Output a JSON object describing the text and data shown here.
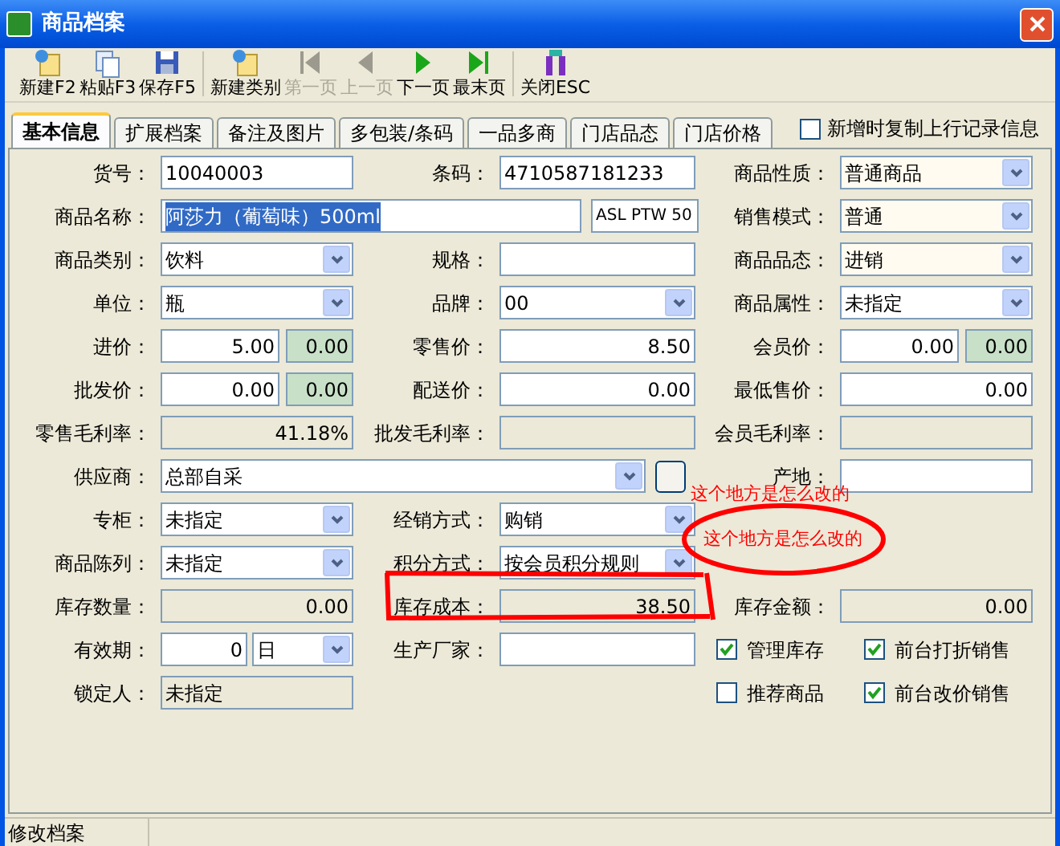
{
  "window": {
    "title": "商品档案"
  },
  "toolbar": [
    {
      "label": "新建F2",
      "kind": "new",
      "disabled": false,
      "separator_before": false
    },
    {
      "label": "粘贴F3",
      "kind": "paste",
      "disabled": false,
      "separator_before": false
    },
    {
      "label": "保存F5",
      "kind": "save",
      "disabled": false,
      "separator_before": false
    },
    {
      "label": "新建类别",
      "kind": "new",
      "disabled": false,
      "separator_before": true
    },
    {
      "label": "第一页",
      "kind": "first",
      "disabled": true,
      "separator_before": false
    },
    {
      "label": "上一页",
      "kind": "prev",
      "disabled": true,
      "separator_before": false
    },
    {
      "label": "下一页",
      "kind": "next",
      "disabled": false,
      "separator_before": false
    },
    {
      "label": "最末页",
      "kind": "last",
      "disabled": false,
      "separator_before": false
    },
    {
      "label": "关闭ESC",
      "kind": "exit",
      "disabled": false,
      "separator_before": true
    }
  ],
  "tabs": [
    {
      "label": "基本信息",
      "selected": true
    },
    {
      "label": "扩展档案",
      "selected": false
    },
    {
      "label": "备注及图片",
      "selected": false
    },
    {
      "label": "多包装/条码",
      "selected": false
    },
    {
      "label": "一品多商",
      "selected": false
    },
    {
      "label": "门店品态",
      "selected": false
    },
    {
      "label": "门店价格",
      "selected": false
    }
  ],
  "copy_option": {
    "label": "新增时复制上行记录信息",
    "checked": false
  },
  "form_rows": [
    {
      "cells": [
        {
          "kind": "text",
          "label": "货号：",
          "value": "10040003",
          "numeric": false
        },
        {
          "kind": "text",
          "label": "条码：",
          "value": "4710587181233",
          "numeric": false
        },
        {
          "kind": "combo",
          "label": "商品性质：",
          "value": "普通商品",
          "highlighted": true
        }
      ]
    },
    {
      "cells": [
        {
          "kind": "name",
          "label": "商品名称：",
          "value": "阿莎力（葡萄味）500ml",
          "text_selected": true,
          "extra": "ASL PTW 50"
        },
        {
          "kind": "combo",
          "label": "销售模式：",
          "value": "普通",
          "highlighted": true
        }
      ]
    },
    {
      "cells": [
        {
          "kind": "combo",
          "label": "商品类别：",
          "value": "饮料",
          "highlighted": false
        },
        {
          "kind": "text",
          "label": "规格："
        },
        {
          "kind": "combo",
          "label": "商品品态：",
          "value": "进销",
          "highlighted": true
        }
      ]
    },
    {
      "cells": [
        {
          "kind": "combo",
          "label": "单位：",
          "value": "瓶",
          "highlighted": false
        },
        {
          "kind": "combo",
          "label": "品牌：",
          "value": "00",
          "highlighted": false
        },
        {
          "kind": "combo",
          "label": "商品属性：",
          "value": "未指定",
          "highlighted": false
        }
      ]
    },
    {
      "cells": [
        {
          "kind": "price",
          "label": "进价：",
          "value": "5.00",
          "markup": "0.00"
        },
        {
          "kind": "text",
          "label": "零售价：",
          "value": "8.50",
          "numeric": true
        },
        {
          "kind": "price",
          "label": "会员价：",
          "value": "0.00",
          "markup": "0.00"
        }
      ]
    },
    {
      "cells": [
        {
          "kind": "price",
          "label": "批发价：",
          "value": "0.00",
          "markup": "0.00"
        },
        {
          "kind": "text",
          "label": "配送价：",
          "value": "0.00",
          "numeric": true
        },
        {
          "kind": "text",
          "label": "最低售价：",
          "value": "0.00",
          "numeric": true
        }
      ]
    },
    {
      "cells": [
        {
          "kind": "readonly",
          "label": "零售毛利率：",
          "value": "41.18%",
          "numeric": true
        },
        {
          "kind": "readonly",
          "label": "批发毛利率："
        },
        {
          "kind": "readonly",
          "label": "会员毛利率："
        }
      ]
    },
    {
      "cells": [
        {
          "kind": "supplier",
          "label": "供应商：",
          "value": "总部自采"
        },
        {
          "kind": "text",
          "label": "产地："
        }
      ]
    },
    {
      "cells": [
        {
          "kind": "combo",
          "label": "专柜：",
          "value": "未指定",
          "highlighted": false
        },
        {
          "kind": "combo",
          "label": "经销方式：",
          "value": "购销",
          "highlighted": false
        },
        {
          "kind": "empty"
        }
      ]
    },
    {
      "cells": [
        {
          "kind": "combo",
          "label": "商品陈列：",
          "value": "未指定",
          "highlighted": false
        },
        {
          "kind": "combo",
          "label": "积分方式：",
          "value": "按会员积分规则",
          "highlighted": false
        },
        {
          "kind": "empty"
        }
      ]
    },
    {
      "cells": [
        {
          "kind": "readonly",
          "label": "库存数量：",
          "value": "0.00",
          "numeric": true
        },
        {
          "kind": "readonly",
          "label": "库存成本：",
          "value": "38.50",
          "numeric": true
        },
        {
          "kind": "readonly",
          "label": "库存金额：",
          "value": "0.00",
          "numeric": true
        }
      ]
    },
    {
      "cells": [
        {
          "kind": "expiry",
          "label": "有效期：",
          "value": "0",
          "unit": "日"
        },
        {
          "kind": "text",
          "label": "生产厂家："
        },
        {
          "kind": "checks",
          "items": [
            {
              "label": "管理库存",
              "checked": true
            },
            {
              "label": "前台打折销售",
              "checked": true
            }
          ]
        }
      ]
    },
    {
      "cells": [
        {
          "kind": "readonly",
          "label": "锁定人：",
          "value": "未指定",
          "numeric": false
        },
        {
          "kind": "empty"
        },
        {
          "kind": "checks",
          "items": [
            {
              "label": "推荐商品",
              "checked": false
            },
            {
              "label": "前台改价销售",
              "checked": true
            }
          ]
        }
      ]
    }
  ],
  "annotations": [
    {
      "text": "这个地方是怎么改的"
    },
    {
      "text": "这个地方是怎么改的"
    }
  ],
  "status_bar": [
    "修改档案"
  ]
}
